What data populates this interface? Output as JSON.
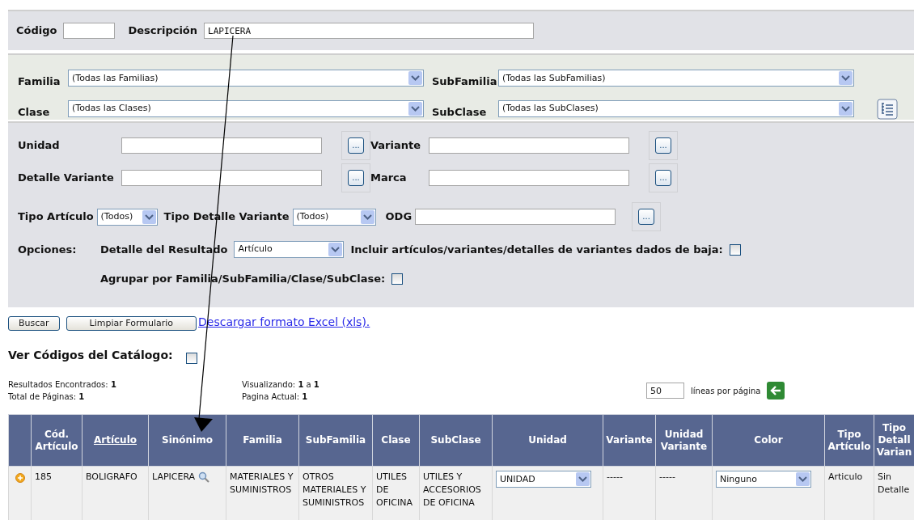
{
  "search": {
    "codigo": {
      "label": "Código"
    },
    "descripcion": {
      "label": "Descripción",
      "value": "LAPICERA"
    }
  },
  "filters": [
    {
      "label": "Familia",
      "value": "(Todas las Familias)"
    },
    {
      "label": "SubFamilia",
      "value": "(Todas las SubFamilias)"
    },
    {
      "label": "Clase",
      "value": "(Todas las Clases)"
    },
    {
      "label": "SubClase",
      "value": "(Todas las SubClases)"
    }
  ],
  "lookups": [
    {
      "label": "Unidad",
      "button": "..."
    },
    {
      "label": "Variante",
      "button": "..."
    },
    {
      "label": "Detalle Variante",
      "button": "..."
    },
    {
      "label": "Marca",
      "button": "..."
    }
  ],
  "type_row": {
    "tipo_articulo": {
      "label": "Tipo Artículo",
      "value": "(Todos)"
    },
    "tipo_detalle": {
      "label": "Tipo Detalle Variante",
      "value": "(Todos)"
    },
    "odg": {
      "label": "ODG",
      "button": "..."
    }
  },
  "options": {
    "label": "Opciones:",
    "detalle": {
      "label": "Detalle del Resultado",
      "value": "Artículo"
    },
    "incluir": {
      "label": "Incluir artículos/variantes/detalles de variantes dados de baja:",
      "checked": false
    },
    "agrupar": {
      "label": "Agrupar por Familia/SubFamilia/Clase/SubClase:",
      "checked": false
    }
  },
  "actions": {
    "buttons": [
      "Buscar",
      "Limpiar Formulario"
    ],
    "link": "Descargar formato Excel (xls)."
  },
  "ver_codigos": {
    "label": "Ver Códigos del Catálogo:",
    "checked": false
  },
  "stats": [
    "Resultados Encontrados: **1**",
    "Total de Páginas: **1**",
    "Visualizando: **1** a **1**",
    "Pagina Actual: **1**"
  ],
  "page_size": {
    "value": "50",
    "label": "líneas por página"
  },
  "table": {
    "columns": [
      {
        "label": "Cód. Artículo",
        "sortable": false
      },
      {
        "label": "Artículo",
        "sortable": true
      },
      {
        "label": "Sinónimo",
        "sortable": false
      },
      {
        "label": "Familia",
        "sortable": false
      },
      {
        "label": "SubFamilia",
        "sortable": false
      },
      {
        "label": "Clase",
        "sortable": false
      },
      {
        "label": "SubClase",
        "sortable": false
      },
      {
        "label": "Unidad",
        "sortable": false
      },
      {
        "label": "Variante",
        "sortable": false
      },
      {
        "label": "Unidad Variante",
        "sortable": false
      },
      {
        "label": "Color",
        "sortable": false
      },
      {
        "label": "Tipo Artículo",
        "sortable": false
      },
      {
        "label": "Tipo Detall Varian",
        "sortable": false
      }
    ],
    "rows": [
      {
        "cells": [
          {
            "kind": "text",
            "text": "185"
          },
          {
            "kind": "text",
            "text": "BOLIGRAFO"
          },
          {
            "kind": "synonym",
            "text": "LAPICERA"
          },
          {
            "kind": "text",
            "text": "MATERIALES Y SUMINISTROS"
          },
          {
            "kind": "text",
            "text": "OTROS MATERIALES Y SUMINISTROS"
          },
          {
            "kind": "text",
            "text": "UTILES DE OFICINA"
          },
          {
            "kind": "text",
            "text": "UTILES Y ACCESORIOS DE OFICINA"
          },
          {
            "kind": "select",
            "text": "UNIDAD"
          },
          {
            "kind": "text",
            "text": "-----"
          },
          {
            "kind": "text",
            "text": "-----"
          },
          {
            "kind": "select",
            "text": "Ninguno"
          },
          {
            "kind": "text",
            "text": "Articulo"
          },
          {
            "kind": "text",
            "text": "Sin Detalle"
          }
        ]
      }
    ]
  }
}
